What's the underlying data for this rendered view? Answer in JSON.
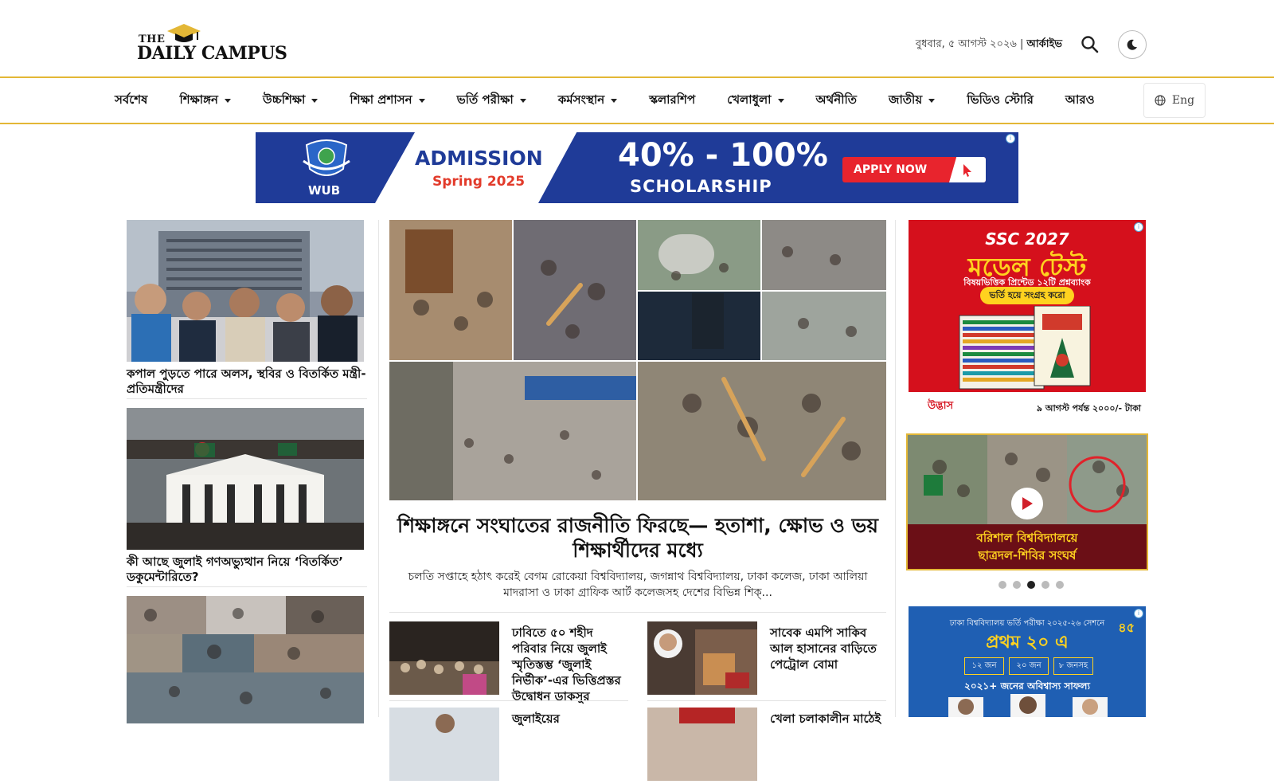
{
  "header": {
    "logo_the": "THE",
    "logo_name": "DAILY CAMPUS",
    "date": "বুধবার, ৫ আগস্ট ২০২৬",
    "archive": "আর্কাইভ",
    "search_icon": "search-icon",
    "dark_mode_icon": "moon-icon"
  },
  "nav": {
    "items": [
      {
        "label": "সর্বশেষ",
        "dropdown": false
      },
      {
        "label": "শিক্ষাঙ্গন",
        "dropdown": true
      },
      {
        "label": "উচ্চশিক্ষা",
        "dropdown": true
      },
      {
        "label": "শিক্ষা প্রশাসন",
        "dropdown": true
      },
      {
        "label": "ভর্তি পরীক্ষা",
        "dropdown": true
      },
      {
        "label": "কর্মসংস্থান",
        "dropdown": true
      },
      {
        "label": "স্কলারশিপ",
        "dropdown": false
      },
      {
        "label": "খেলাধুলা",
        "dropdown": true
      },
      {
        "label": "অর্থনীতি",
        "dropdown": false
      },
      {
        "label": "জাতীয়",
        "dropdown": true
      },
      {
        "label": "ভিডিও স্টোরি",
        "dropdown": false
      },
      {
        "label": "আরও",
        "dropdown": false
      }
    ],
    "language": "Eng"
  },
  "banner_ad": {
    "brand": "WUB",
    "headline": "ADMISSION",
    "term": "Spring 2025",
    "scholarship": "40% - 100%",
    "scholarship_label": "SCHOLARSHIP",
    "cta": "APPLY NOW"
  },
  "left_stories": [
    {
      "title": "কপাল পুড়তে পারে অলস, স্থবির ও বিতর্কিত মন্ত্রী-প্রতিমন্ত্রীদের"
    },
    {
      "title": "কী আছে জুলাই গণঅভ্যুত্থান নিয়ে ‘বিতর্কিত’ ডকুমেন্টারিতে?"
    },
    {
      "title": ""
    }
  ],
  "lead": {
    "title": "শিক্ষাঙ্গনে সংঘাতের রাজনীতি ফিরছে— হতাশা, ক্ষোভ ও ভয় শিক্ষার্থীদের মধ্যে",
    "excerpt": "চলতি সপ্তাহে হঠাৎ করেই বেগম রোকেয়া বিশ্ববিদ্যালয়, জগন্নাথ বিশ্ববিদ্যালয়, ঢাকা কলেজ, ঢাকা আলিয়া মাদরাসা ও ঢাকা গ্রাফিক আর্ট কলেজসহ দেশের বিভিন্ন শিক্..."
  },
  "stories": [
    {
      "title": "ঢাবিতে ৫০ শহীদ পরিবার নিয়ে জুলাই স্মৃতিস্তম্ভ ‘জুলাই নির্ভীক’-এর ভিত্তিপ্রস্তর উদ্বোধন ডাকসুর"
    },
    {
      "title": "সাবেক এমপি সাকিব আল হাসানের বাড়িতে পেট্রোল বোমা"
    },
    {
      "title": "জুলাইয়ের"
    },
    {
      "title": "খেলা চলাকালীন মাঠেই"
    }
  ],
  "right": {
    "ssc_ad": {
      "line1": "SSC 2027",
      "line2": "মডেল টেস্ট",
      "line3": "বিষয়ভিত্তিক প্রিন্টেড ১২টি প্রশ্নব্যাংক",
      "pill": "ভর্তি হয়ে সংগ্রহ করো",
      "brand": "উদ্ভাস",
      "price": "৯ আগস্ট পর্যন্ত ২০০০/- টাকা"
    },
    "video": {
      "caption_line1": "বরিশাল বিশ্ববিদ্যালয়ে",
      "caption_line2": "ছাত্রদল-শিবির সংঘর্ষ",
      "play_icon": "play-icon"
    },
    "carousel": {
      "count": 5,
      "active_index": 2
    },
    "du_ad": {
      "header": "ঢাকা বিশ্ববিদ্যালয় ভর্তি পরীক্ষা ২০২৫-২৬ সেশনে",
      "big": "প্রথম ২০ এ",
      "boxes": [
        "১২ জন",
        "২০ জন",
        "৮ জনসহ"
      ],
      "success": "২০২১+ জনের অবিশ্বাস্য সাফল্য",
      "badge": "৪৫"
    }
  },
  "colors": {
    "accent": "#e3b736",
    "ad_blue": "#1f3b98",
    "ad_red": "#d5101c",
    "video_caption": "#6b0f16"
  }
}
